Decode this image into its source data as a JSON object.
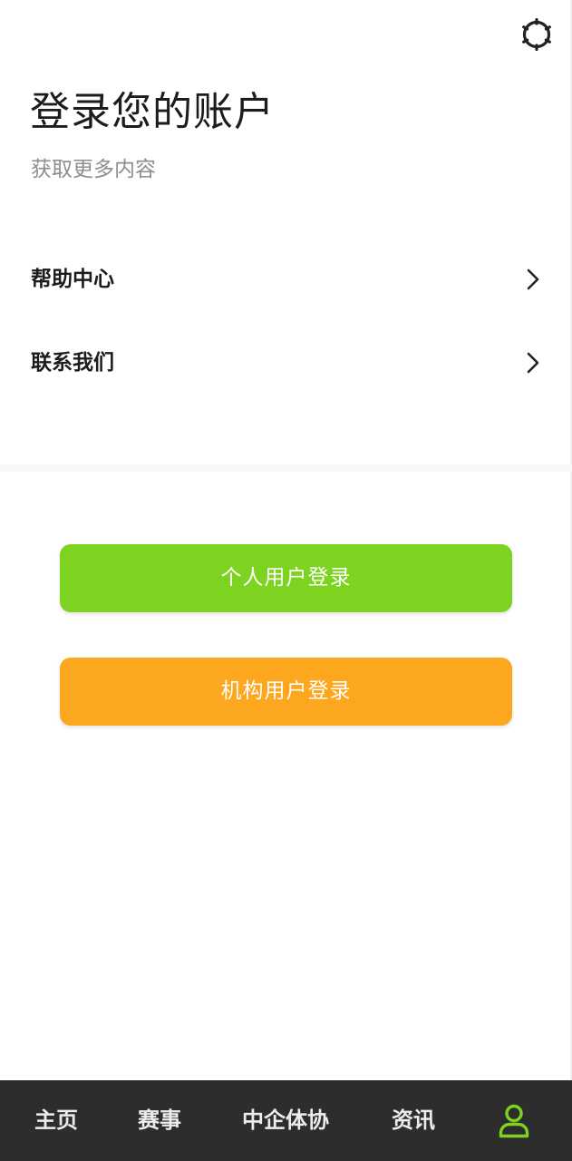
{
  "header": {
    "title": "登录您的账户",
    "subtitle": "获取更多内容",
    "settings_icon": "settings-gear-icon"
  },
  "menu": {
    "items": [
      {
        "label": "帮助中心",
        "icon": "chevron-right-icon"
      },
      {
        "label": "联系我们",
        "icon": "chevron-right-icon"
      }
    ]
  },
  "login": {
    "personal_label": "个人用户登录",
    "personal_color": "#7ed321",
    "org_label": "机构用户登录",
    "org_color": "#fda71e"
  },
  "tabbar": {
    "items": [
      {
        "label": "主页"
      },
      {
        "label": "赛事"
      },
      {
        "label": "中企体协"
      },
      {
        "label": "资讯"
      }
    ],
    "active_icon": "user-profile-icon",
    "active_color": "#7ed321",
    "background": "#2d2d2d"
  }
}
